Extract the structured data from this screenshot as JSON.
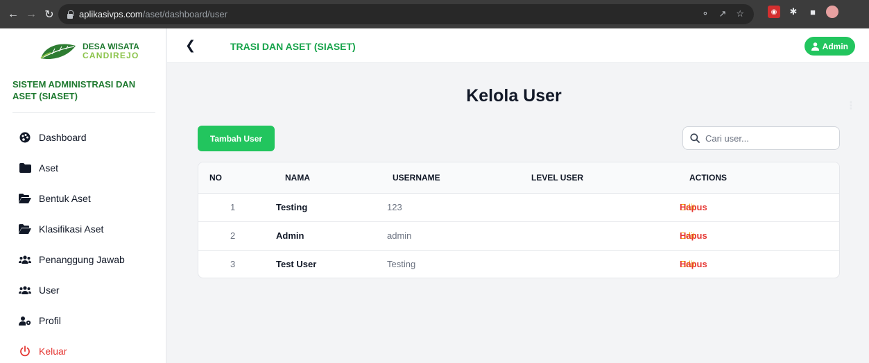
{
  "browser": {
    "url_host": "aplikasivps.com",
    "url_path": "/aset/dashboard/user"
  },
  "sidebar": {
    "brand_line1": "DESA WISATA",
    "brand_line2": "CANDIREJO",
    "system_name": "SISTEM ADMINISTRASI DAN ASET (SIASET)",
    "items": [
      {
        "label": "Dashboard",
        "icon": "palette-icon"
      },
      {
        "label": "Aset",
        "icon": "folder-icon"
      },
      {
        "label": "Bentuk Aset",
        "icon": "folder-open-icon"
      },
      {
        "label": "Klasifikasi Aset",
        "icon": "folder-open-icon"
      },
      {
        "label": "Penanggung Jawab",
        "icon": "users-icon"
      },
      {
        "label": "User",
        "icon": "users-icon"
      },
      {
        "label": "Profil",
        "icon": "user-gear-icon"
      },
      {
        "label": "Keluar",
        "icon": "power-icon"
      }
    ]
  },
  "topbar": {
    "title": "TRASI DAN ASET (SIASET)",
    "admin_label": "Admin"
  },
  "main": {
    "page_title": "Kelola User",
    "add_button": "Tambah User",
    "search_placeholder": "Cari user..."
  },
  "table": {
    "headers": {
      "no": "NO",
      "nama": "NAMA",
      "username": "USERNAME",
      "level": "LEVEL USER",
      "actions": "ACTIONS"
    },
    "rows": [
      {
        "no": "1",
        "nama": "Testing",
        "username": "123",
        "level": "",
        "edit": "Edit",
        "hapus": "Hapus"
      },
      {
        "no": "2",
        "nama": "Admin",
        "username": "admin",
        "level": "",
        "edit": "Edit",
        "hapus": "Hapus"
      },
      {
        "no": "3",
        "nama": "Test User",
        "username": "Testing",
        "level": "",
        "edit": "Edit",
        "hapus": "Hapus"
      }
    ]
  },
  "colors": {
    "accent_green": "#22c55e",
    "brand_green": "#1f7a30",
    "edit_yellow": "#f5b400",
    "danger_red": "#e53935"
  }
}
